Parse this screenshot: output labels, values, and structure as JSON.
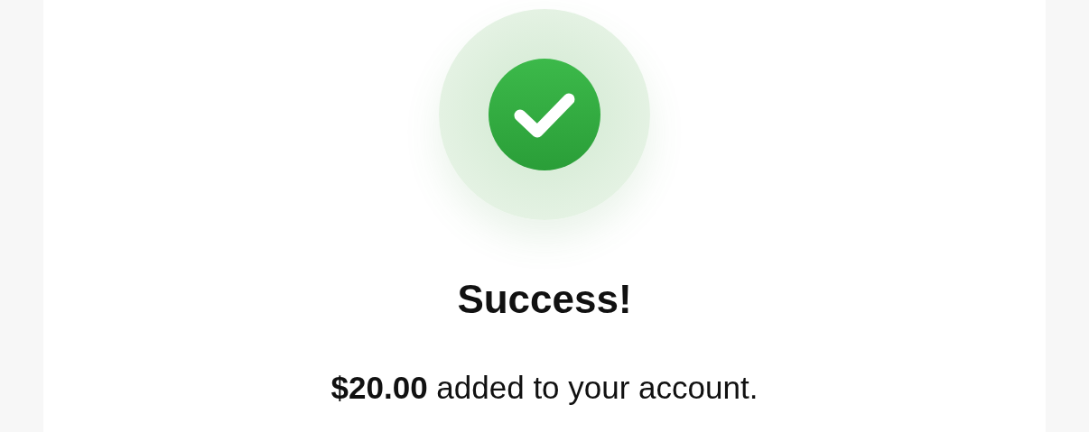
{
  "status": {
    "kind": "success"
  },
  "title": "Success!",
  "message": "**$20.00** added to your account."
}
